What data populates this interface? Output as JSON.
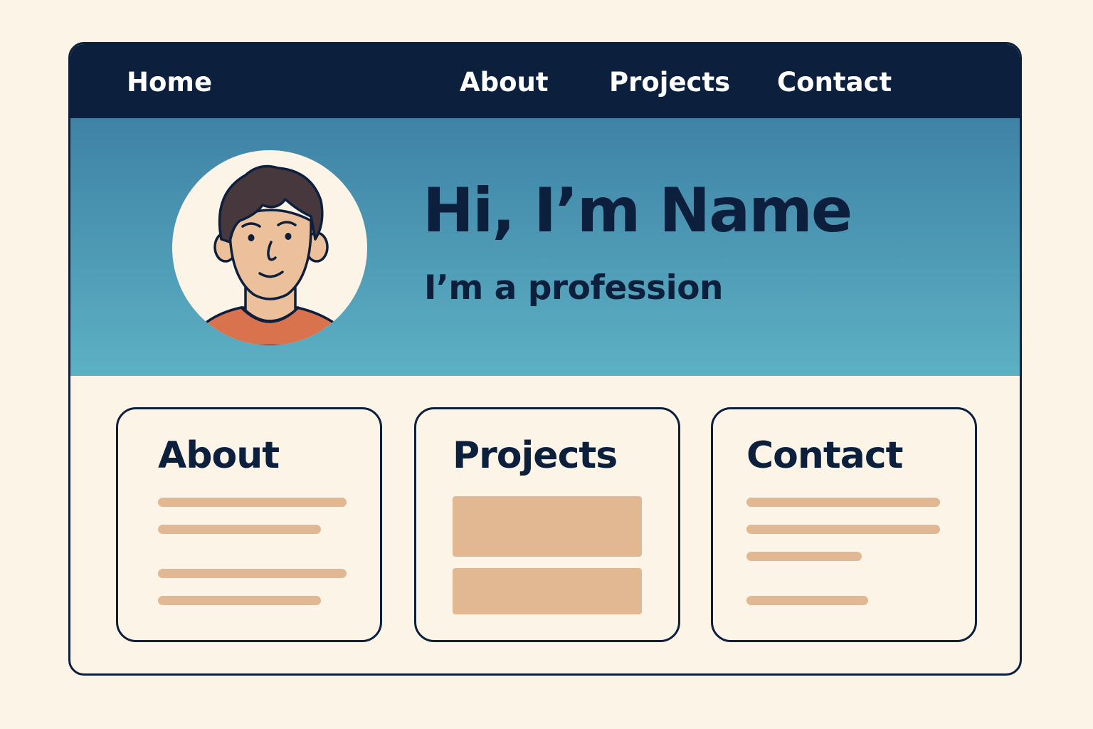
{
  "nav": {
    "home": "Home",
    "about": "About",
    "projects": "Projects",
    "contact": "Contact"
  },
  "hero": {
    "title": "Hi, I’m Name",
    "subtitle": "I’m a profession",
    "avatar_icon": "avatar-illustration"
  },
  "cards": {
    "about": {
      "title": "About"
    },
    "projects": {
      "title": "Projects"
    },
    "contact": {
      "title": "Contact"
    }
  },
  "colors": {
    "navy": "#0c1f3d",
    "background": "#fdf4e8",
    "hero_gradient_top": "#3f82a6",
    "hero_gradient_bottom": "#5db1c4",
    "placeholder": "#e2b893",
    "shirt": "#d8734e",
    "skin": "#ecc09a",
    "hair": "#46383c"
  }
}
